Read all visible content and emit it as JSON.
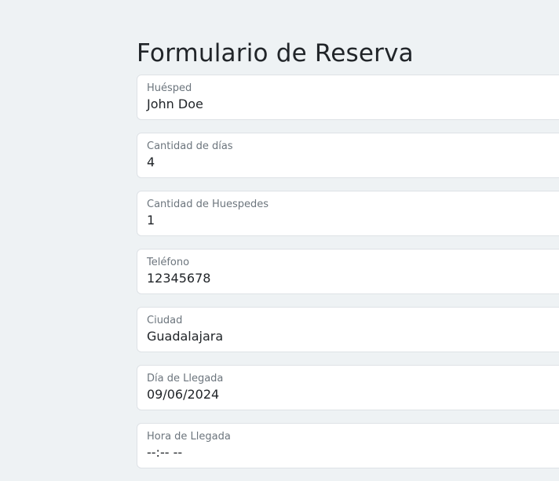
{
  "form": {
    "title": "Formulario de Reserva",
    "fields": [
      {
        "label": "Huésped",
        "value": "John Doe"
      },
      {
        "label": "Cantidad de días",
        "value": "4"
      },
      {
        "label": "Cantidad de Huespedes",
        "value": "1"
      },
      {
        "label": "Teléfono",
        "value": "12345678"
      },
      {
        "label": "Ciudad",
        "value": "Guadalajara"
      },
      {
        "label": "Día de Llegada",
        "value": "09/06/2024"
      },
      {
        "label": "Hora de Llegada",
        "value": "--:-- --"
      }
    ]
  },
  "colors": {
    "background": "#eef2f4",
    "field_background": "#ffffff",
    "field_border": "#dee2e6",
    "label_text": "#6c757d",
    "value_text": "#212529"
  }
}
